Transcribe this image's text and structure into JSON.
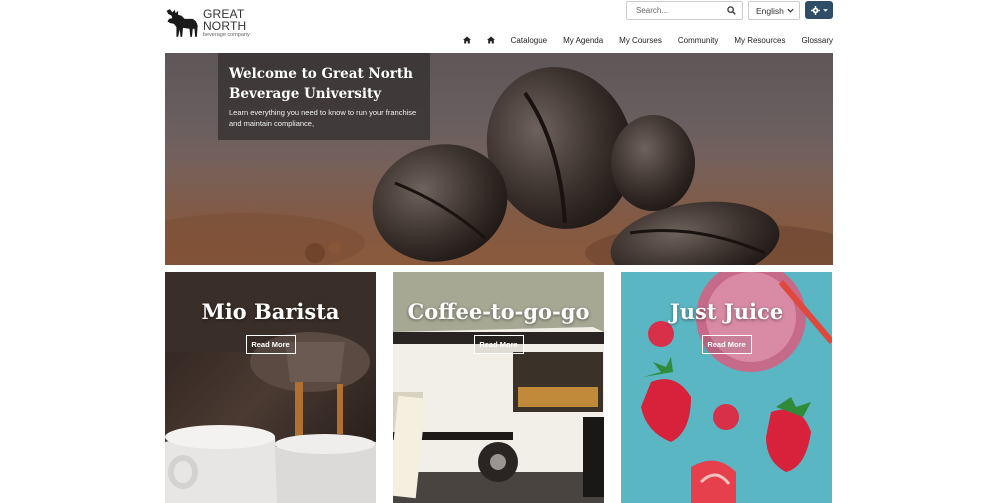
{
  "brand": {
    "name": "GREAT NORTH",
    "tagline": "beverage company"
  },
  "header": {
    "search_placeholder": "Search...",
    "language": "English"
  },
  "nav": {
    "items": [
      "Catalogue",
      "My Agenda",
      "My Courses",
      "Community",
      "My Resources",
      "Glossary"
    ]
  },
  "hero": {
    "title": "Welcome to Great North Beverage University",
    "subtitle": "Learn everything you need to know to run your franchise and maintain compliance,"
  },
  "cards": [
    {
      "title": "Mio Barista",
      "button": "Read More"
    },
    {
      "title": "Coffee-to-go-go",
      "button": "Read More"
    },
    {
      "title": "Just Juice",
      "button": "Read More"
    }
  ],
  "colors": {
    "settings_button": "#2f4d66",
    "juice_bg": "#5bb6c4"
  },
  "icons": [
    "moose-logo-icon",
    "search-icon",
    "chevron-down-icon",
    "gear-icon",
    "home-icon"
  ]
}
